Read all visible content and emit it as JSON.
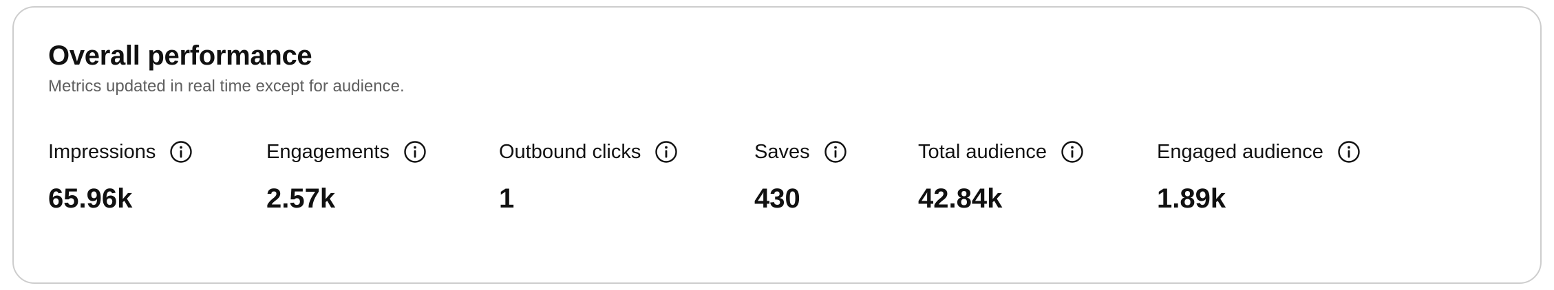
{
  "header": {
    "title": "Overall performance",
    "subtitle": "Metrics updated in real time except for audience."
  },
  "metrics": [
    {
      "label": "Impressions",
      "value": "65.96k",
      "icon": "info-icon"
    },
    {
      "label": "Engagements",
      "value": "2.57k",
      "icon": "info-icon"
    },
    {
      "label": "Outbound clicks",
      "value": "1",
      "icon": "info-icon"
    },
    {
      "label": "Saves",
      "value": "430",
      "icon": "info-icon"
    },
    {
      "label": "Total audience",
      "value": "42.84k",
      "icon": "info-icon"
    },
    {
      "label": "Engaged audience",
      "value": "1.89k",
      "icon": "info-icon"
    }
  ]
}
